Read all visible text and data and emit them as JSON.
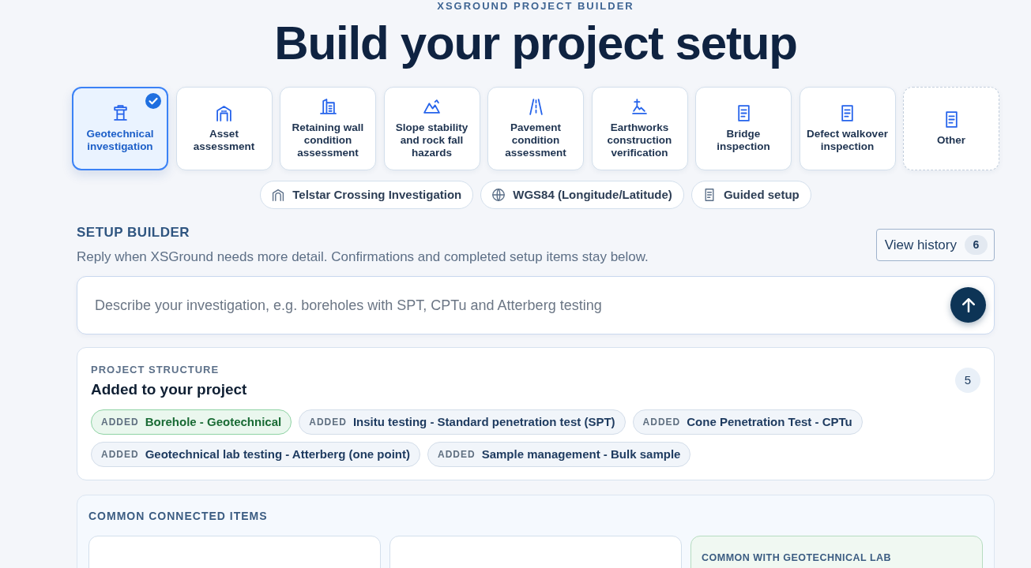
{
  "header": {
    "eyebrow": "XSGROUND PROJECT BUILDER",
    "title": "Build your project setup"
  },
  "project_types": [
    {
      "kind": "drill",
      "label": "Geotechnical investigation",
      "selected": true
    },
    {
      "kind": "warehouse",
      "label": "Asset assessment",
      "selected": false
    },
    {
      "kind": "wall",
      "label": "Retaining wall condition assessment",
      "selected": false
    },
    {
      "kind": "slope",
      "label": "Slope stability and rock fall hazards",
      "selected": false
    },
    {
      "kind": "road",
      "label": "Pavement condition assessment",
      "selected": false
    },
    {
      "kind": "earthworks",
      "label": "Earthworks construction verification",
      "selected": false
    },
    {
      "kind": "document",
      "label": "Bridge inspection",
      "selected": false
    },
    {
      "kind": "document",
      "label": "Defect walkover inspection",
      "selected": false
    },
    {
      "kind": "custom",
      "label": "Other",
      "selected": false
    }
  ],
  "context_chips": [
    {
      "kind": "project",
      "label": "Telstar Crossing Investigation"
    },
    {
      "kind": "crs",
      "label": "WGS84 (Longitude/Latitude)"
    },
    {
      "kind": "mode",
      "label": "Guided setup"
    }
  ],
  "setup_builder": {
    "heading": "SETUP BUILDER",
    "description": "Reply when XSGround needs more detail. Confirmations and completed setup items stay below.",
    "history_button": {
      "label": "View history",
      "count": "6"
    },
    "prompt": {
      "placeholder": "Describe your investigation, e.g. boreholes with SPT, CPTu and Atterberg testing"
    }
  },
  "project_structure": {
    "eyebrow": "PROJECT STRUCTURE",
    "title": "Added to your project",
    "count": "5",
    "items": [
      {
        "tag": "ADDED",
        "label": "Borehole - Geotechnical",
        "highlighted": true
      },
      {
        "tag": "ADDED",
        "label": "Insitu testing - Standard penetration test (SPT)",
        "highlighted": false
      },
      {
        "tag": "ADDED",
        "label": "Cone Penetration Test - CPTu",
        "highlighted": false
      },
      {
        "tag": "ADDED",
        "label": "Geotechnical lab testing - Atterberg (one point)",
        "highlighted": false
      },
      {
        "tag": "ADDED",
        "label": "Sample management - Bulk sample",
        "highlighted": false
      }
    ]
  },
  "common_connected": {
    "heading": "COMMON CONNECTED ITEMS",
    "groups": [
      {
        "highlighted": false
      },
      {
        "highlighted": false
      },
      {
        "heading": "COMMON WITH GEOTECHNICAL LAB",
        "highlighted": true
      }
    ]
  }
}
